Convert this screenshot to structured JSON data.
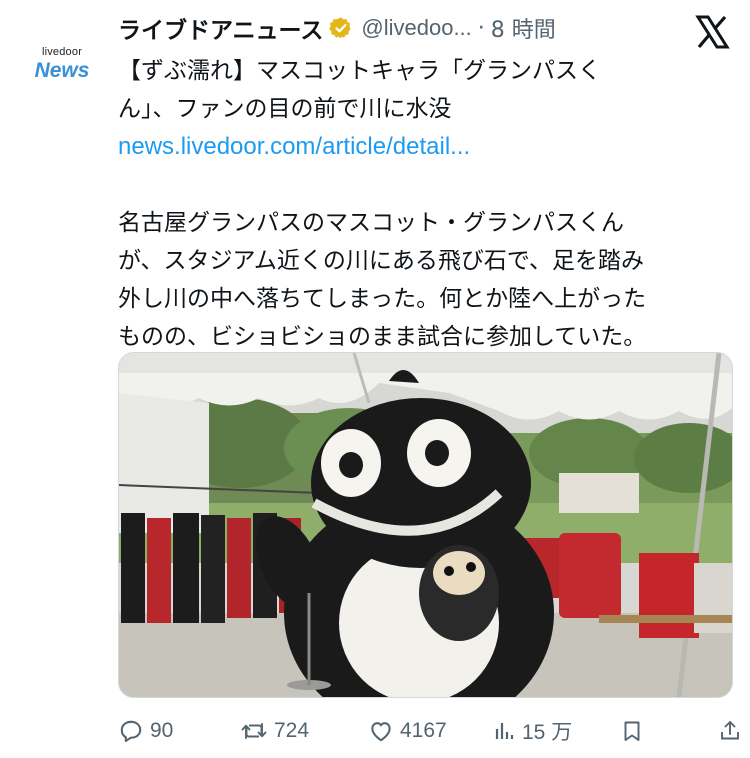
{
  "account": {
    "avatar_small": "livedoor",
    "avatar_big": "News",
    "display_name": "ライブドアニュース",
    "handle": "@livedoo...",
    "separator": "·",
    "time": "8 時間",
    "verified_icon": "verified-badge-icon",
    "brand_color": "#3a8fd6",
    "verified_color": "#e2b719"
  },
  "tweet": {
    "headline_line1": "【ずぶ濡れ】マスコットキャラ「グランパスく",
    "headline_line2": "ん」、ファンの目の前で川に水没",
    "link": "news.livedoor.com/article/detail...",
    "body_line1": "名古屋グランパスのマスコット・グランパスくん",
    "body_line2": "が、スタジアム近くの川にある飛び石で、足を踏み",
    "body_line3": "外し川の中へ落ちてしまった。何とか陸へ上がった",
    "body_line4": "ものの、ビショビショのまま試合に参加していた。",
    "link_color": "#1d9bf0"
  },
  "actions": {
    "reply_count": "90",
    "repost_count": "724",
    "like_count": "4167",
    "views_count": "15 万"
  },
  "icons": [
    "x-logo-icon",
    "reply-icon",
    "repost-icon",
    "like-icon",
    "views-icon",
    "bookmark-icon",
    "share-icon"
  ]
}
